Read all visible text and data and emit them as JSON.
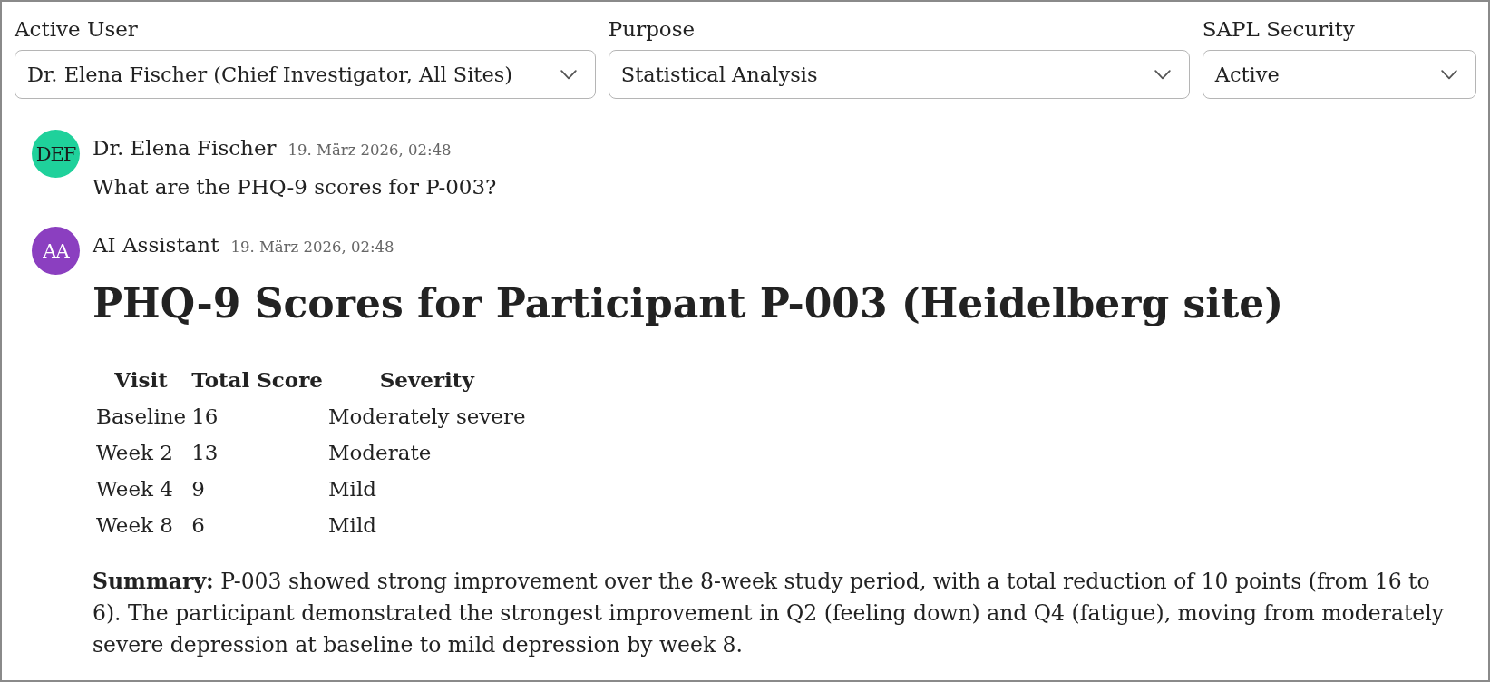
{
  "filters": [
    {
      "label": "Active User",
      "value": "Dr. Elena Fischer (Chief Investigator, All Sites)"
    },
    {
      "label": "Purpose",
      "value": "Statistical Analysis"
    },
    {
      "label": "SAPL Security",
      "value": "Active"
    }
  ],
  "messages": [
    {
      "initials": "DEF",
      "color": "#1fd19b",
      "author": "Dr. Elena Fischer",
      "time": "19. März 2026, 02:48",
      "blocks": [
        {
          "kind": "paragraph",
          "text": "What are the PHQ-9 scores for P-003?"
        }
      ]
    },
    {
      "initials": "AA",
      "color": "#8b3fc0",
      "author": "AI Assistant",
      "time": "19. März 2026, 02:48",
      "blocks": [
        {
          "kind": "heading",
          "text": "PHQ-9 Scores for Participant P-003 (Heidelberg site)"
        },
        {
          "kind": "table",
          "columns": [
            "Visit",
            "Total Score",
            "Severity"
          ],
          "rows": [
            [
              "Baseline",
              "16",
              "Moderately severe"
            ],
            [
              "Week 2",
              "13",
              "Moderate"
            ],
            [
              "Week 4",
              "9",
              "Mild"
            ],
            [
              "Week 8",
              "6",
              "Mild"
            ]
          ]
        },
        {
          "kind": "paragraph",
          "text": "**Summary:** P-003 showed strong improvement over the 8-week study period, with a total reduction of 10 points (from 16 to 6). The participant demonstrated the strongest improvement in Q2 (feeling down) and Q4 (fatigue), moving from moderately severe depression at baseline to mild depression by week 8."
        }
      ]
    }
  ]
}
